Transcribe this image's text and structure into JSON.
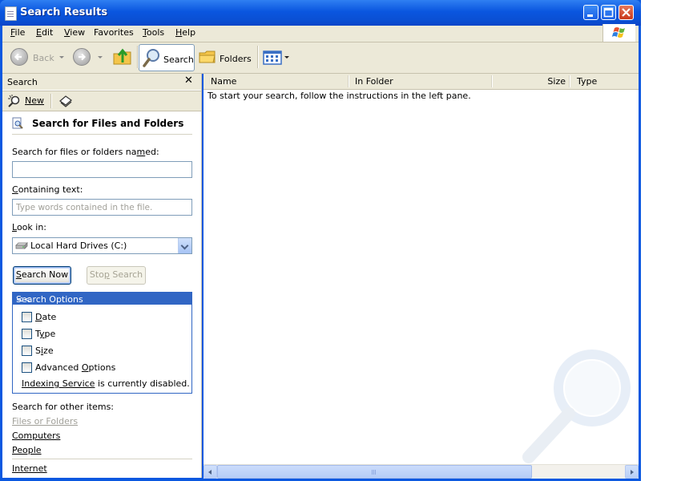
{
  "window": {
    "title": "Search Results"
  },
  "menubar": {
    "items": [
      {
        "label": "File",
        "key": "F",
        "rest": "ile"
      },
      {
        "label": "Edit",
        "key": "E",
        "rest": "dit"
      },
      {
        "label": "View",
        "key": "V",
        "rest": "iew"
      },
      {
        "label": "Favorites",
        "key": "",
        "rest": "Favorites"
      },
      {
        "label": "Tools",
        "key": "T",
        "rest": "ools"
      },
      {
        "label": "Help",
        "key": "H",
        "rest": "elp"
      }
    ]
  },
  "toolbar": {
    "back_label": "Back",
    "search_label": "Search",
    "folders_label": "Folders"
  },
  "search_pane": {
    "title": "Search",
    "close_glyph": "✕",
    "new_label": "New",
    "heading": "Search for Files and Folders",
    "named_label_pre": "Search for files or folders na",
    "named_label_key": "m",
    "named_label_post": "ed:",
    "named_value": "",
    "containing_label_key": "C",
    "containing_label_post": "ontaining text:",
    "containing_placeholder": "Type words contained in the file.",
    "look_in_label_key": "L",
    "look_in_label_post": "ook in:",
    "look_in_value": "Local Hard Drives (C:)",
    "search_now_key": "S",
    "search_now_post": "earch Now",
    "stop_pre": "Sto",
    "stop_key": "p",
    "stop_post": " Search",
    "options_header": "Search Options",
    "options_collapse": "<<",
    "options": [
      {
        "pre": "",
        "key": "D",
        "post": "ate",
        "checked": false
      },
      {
        "pre": "T",
        "key": "y",
        "post": "pe",
        "checked": false
      },
      {
        "pre": "S",
        "key": "i",
        "post": "ze",
        "checked": false
      },
      {
        "pre": "Advanced ",
        "key": "O",
        "post": "ptions",
        "checked": false
      }
    ],
    "indexing_link": "Indexing Service",
    "indexing_text": " is currently disabled.",
    "other_items_label": "Search for other items:",
    "other_links": {
      "files_or_folders": "Files or Folders",
      "computers": "Computers",
      "people": "People",
      "internet": "Internet"
    }
  },
  "results": {
    "columns": {
      "name": "Name",
      "in_folder": "In Folder",
      "size": "Size",
      "type": "Type"
    },
    "hint": "To start your search, follow the instructions in the left pane."
  }
}
